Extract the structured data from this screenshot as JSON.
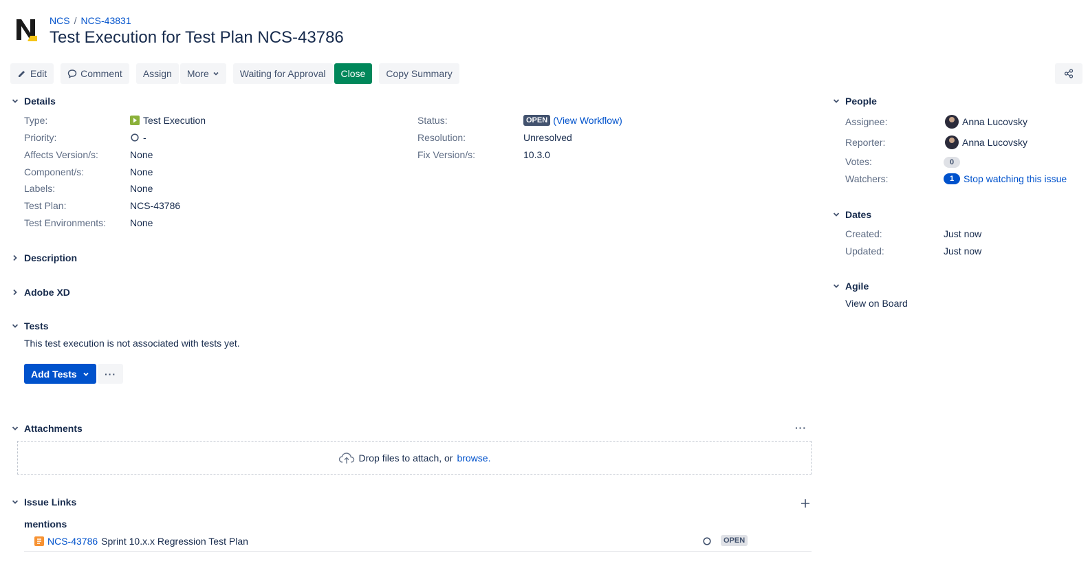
{
  "breadcrumb": {
    "project": "NCS",
    "parent": "NCS-43831"
  },
  "title": "Test Execution for Test Plan NCS-43786",
  "toolbar": {
    "edit": "Edit",
    "comment": "Comment",
    "assign": "Assign",
    "more": "More",
    "waiting": "Waiting for Approval",
    "close": "Close",
    "copy_summary": "Copy Summary"
  },
  "details": {
    "heading": "Details",
    "type_label": "Type:",
    "type_value": "Test Execution",
    "priority_label": "Priority:",
    "priority_value": "-",
    "affects_label": "Affects Version/s:",
    "affects_value": "None",
    "component_label": "Component/s:",
    "component_value": "None",
    "labels_label": "Labels:",
    "labels_value": "None",
    "testplan_label": "Test Plan:",
    "testplan_value": "NCS-43786",
    "testenv_label": "Test Environments:",
    "testenv_value": "None",
    "status_label": "Status:",
    "status_value": "OPEN",
    "view_workflow": "View Workflow",
    "paren_open": "(",
    "paren_close": ")",
    "resolution_label": "Resolution:",
    "resolution_value": "Unresolved",
    "fixversion_label": "Fix Version/s:",
    "fixversion_value": "10.3.0"
  },
  "description": {
    "heading": "Description"
  },
  "adobe_xd": {
    "heading": "Adobe XD"
  },
  "tests": {
    "heading": "Tests",
    "empty_text": "This test execution is not associated with tests yet.",
    "add_tests": "Add Tests",
    "more": "···"
  },
  "attachments": {
    "heading": "Attachments",
    "drop_text": "Drop files to attach, or",
    "browse": "browse.",
    "more": "···"
  },
  "issue_links": {
    "heading": "Issue Links",
    "group": "mentions",
    "link_key": "NCS-43786",
    "link_summary": "Sprint 10.x.x Regression Test Plan",
    "link_status": "OPEN"
  },
  "people": {
    "heading": "People",
    "assignee_label": "Assignee:",
    "assignee_value": "Anna Lucovsky",
    "reporter_label": "Reporter:",
    "reporter_value": "Anna Lucovsky",
    "votes_label": "Votes:",
    "votes_value": "0",
    "watchers_label": "Watchers:",
    "watchers_value": "1",
    "watch_link": "Stop watching this issue"
  },
  "dates": {
    "heading": "Dates",
    "created_label": "Created:",
    "created_value": "Just now",
    "updated_label": "Updated:",
    "updated_value": "Just now"
  },
  "agile": {
    "heading": "Agile",
    "view_board": "View on Board"
  },
  "colors": {
    "link": "#0052cc",
    "green": "#00875a",
    "text": "#172b4d",
    "muted": "#5e6c84"
  }
}
